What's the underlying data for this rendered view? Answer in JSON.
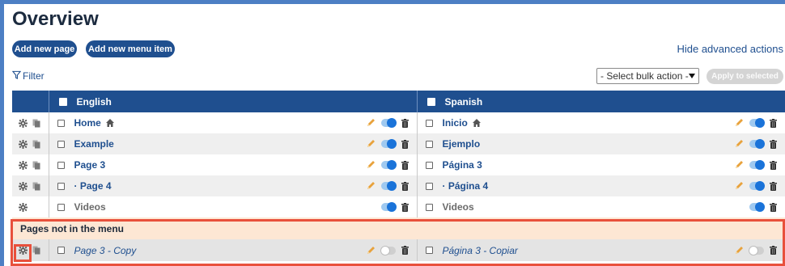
{
  "page": {
    "title": "Overview",
    "add_page_label": "Add new page",
    "add_menu_item_label": "Add new menu item",
    "hide_advanced_label": "Hide advanced actions",
    "filter_label": "Filter",
    "bulk_action_value": "- Select bulk action -",
    "apply_label": "Apply to selected"
  },
  "table": {
    "columns": [
      {
        "label": "English"
      },
      {
        "label": "Spanish"
      }
    ],
    "rows": [
      {
        "en": "Home",
        "es": "Inicio",
        "home": true,
        "toggle": "on",
        "pencil": true,
        "copy": true,
        "grey": false
      },
      {
        "en": "Example",
        "es": "Ejemplo",
        "home": false,
        "toggle": "on",
        "pencil": true,
        "copy": true,
        "grey": false
      },
      {
        "en": "Page 3",
        "es": "Página 3",
        "home": false,
        "toggle": "on",
        "pencil": true,
        "copy": true,
        "grey": false
      },
      {
        "en": "· Page 4",
        "es": "· Página 4",
        "home": false,
        "toggle": "on",
        "pencil": true,
        "copy": true,
        "grey": false
      },
      {
        "en": "Videos",
        "es": "Videos",
        "home": false,
        "toggle": "on",
        "pencil": false,
        "copy": false,
        "grey": true
      }
    ],
    "not_in_menu_label": "Pages not in the menu",
    "not_in_menu_rows": [
      {
        "en": "Page 3 - Copy",
        "es": "Página 3 - Copiar",
        "toggle": "off"
      }
    ]
  },
  "icons": {
    "gear": "gear-icon",
    "copy": "copy-icon",
    "pencil": "pencil-icon",
    "trash": "trash-icon",
    "home": "home-icon",
    "filter": "filter-icon"
  },
  "colors": {
    "brand": "#1f4f8f",
    "toggle_on": "#1a73d9",
    "pencil": "#e8a23c",
    "section_bg": "#fde7d4",
    "highlight": "#e8503c"
  }
}
